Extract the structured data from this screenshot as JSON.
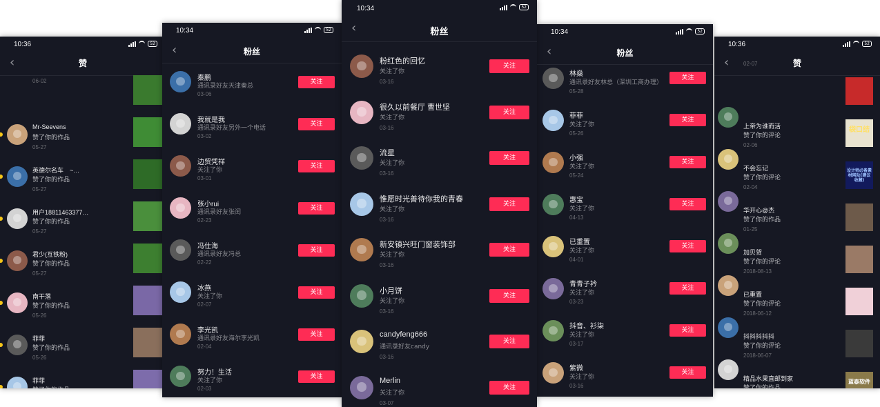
{
  "status_bar": {
    "time_left": "10:36",
    "time_left2": "10:34",
    "time_center": "10:34",
    "time_right2": "10:34",
    "time_right": "10:36",
    "battery": "52"
  },
  "screens": {
    "likes_left": {
      "title": "赞",
      "rows": [
        {
          "name": "",
          "action": "",
          "date": "06-02"
        },
        {
          "name": "Mr-Seevens",
          "action": "赞了你的作品",
          "date": "05-27"
        },
        {
          "name": "英德尔名车　~…",
          "action": "赞了你的作品",
          "date": "05-27"
        },
        {
          "name": "用户18811463377…",
          "action": "赞了你的作品",
          "date": "05-27"
        },
        {
          "name": "君少(互铁粉)",
          "action": "赞了你的作品",
          "date": "05-27"
        },
        {
          "name": "南干落",
          "action": "赞了你的作品",
          "date": "05-26"
        },
        {
          "name": "菲菲",
          "action": "赞了你的作品",
          "date": "05-26"
        },
        {
          "name": "菲菲",
          "action": "赞了你的作品",
          "date": "05-26"
        }
      ]
    },
    "fans_left": {
      "title": "粉丝",
      "follow_label": "关注",
      "rows": [
        {
          "name": "秦鹏",
          "sub": "通讯录好友天津秦总",
          "date": "03-06"
        },
        {
          "name": "我就是我",
          "sub": "通讯录好友另外一个电话",
          "date": "03-02"
        },
        {
          "name": "边贸凭祥",
          "sub": "关注了你",
          "date": "03-01"
        },
        {
          "name": "张小rui",
          "sub": "通讯录好友张闰",
          "date": "02-23"
        },
        {
          "name": "冯仕海",
          "sub": "通讯录好友冯总",
          "date": "02-22"
        },
        {
          "name": "冰燕",
          "sub": "关注了你",
          "date": "02-07"
        },
        {
          "name": "李光凯",
          "sub": "通讯录好友海尔李光凯",
          "date": "02-04"
        },
        {
          "name": "努力！生活",
          "sub": "关注了你",
          "date": "02-03"
        }
      ]
    },
    "fans_center": {
      "title": "粉丝",
      "follow_label": "关注",
      "rows": [
        {
          "name": "粉红色的回忆",
          "sub": "关注了你",
          "date": "03-16"
        },
        {
          "name": "很久以前餐厅  曹世坚",
          "sub": "关注了你",
          "date": "03-16"
        },
        {
          "name": "流星",
          "sub": "关注了你",
          "date": "03-16"
        },
        {
          "name": "惟愿时光善待你我的青春",
          "sub": "关注了你",
          "date": "03-16"
        },
        {
          "name": "新安镇兴旺门窗装饰部",
          "sub": "关注了你",
          "date": "03-16"
        },
        {
          "name": "小月饼",
          "sub": "关注了你",
          "date": "03-16"
        },
        {
          "name": "candyfeng666",
          "sub": "通讯录好友candy",
          "date": "03-16"
        },
        {
          "name": "Merlin",
          "sub": "关注了你",
          "date": "03-07"
        }
      ]
    },
    "fans_right": {
      "title": "粉丝",
      "follow_label": "关注",
      "rows": [
        {
          "name": "林燊",
          "sub": "通讯录好友林总（深圳工商办理）",
          "date": "05-28"
        },
        {
          "name": "菲菲",
          "sub": "关注了你",
          "date": "05-26"
        },
        {
          "name": "小强",
          "sub": "关注了你",
          "date": "05-24"
        },
        {
          "name": "惠宝",
          "sub": "关注了你",
          "date": "04-13"
        },
        {
          "name": "已重置",
          "sub": "关注了你",
          "date": "04-01"
        },
        {
          "name": "青青子衿",
          "sub": "关注了你",
          "date": "03-23"
        },
        {
          "name": "抖音、衫柒",
          "sub": "关注了你",
          "date": "03-17"
        },
        {
          "name": "紫微",
          "sub": "关注了你",
          "date": "03-16"
        }
      ]
    },
    "likes_right": {
      "title": "赞",
      "rows": [
        {
          "name": "",
          "action": "",
          "date": "02-07"
        },
        {
          "name": "上帝为谁而活",
          "action": "赞了你的评论",
          "date": "02-06"
        },
        {
          "name": "不会忘记",
          "action": "赞了你的评论",
          "date": "02-04"
        },
        {
          "name": "华开心@杰",
          "action": "赞了你的作品",
          "date": "01-25"
        },
        {
          "name": "加贝贺",
          "action": "赞了你的评论",
          "date": "2018-08-13"
        },
        {
          "name": "已重置",
          "action": "赞了你的评论",
          "date": "2018-06-12"
        },
        {
          "name": "抖抖抖抖抖",
          "action": "赞了你的评论",
          "date": "2018-06-07"
        },
        {
          "name": "精品水果直邮到家",
          "action": "赞了你的作品",
          "date": "2018-06-03"
        }
      ]
    }
  },
  "thumb_texts": {
    "t1": "袋口结",
    "t2": "设计师必备素材网站(建议收藏)",
    "t3": "蓝泰软件"
  },
  "colors": {
    "background": "#161823",
    "accent": "#fe2c55",
    "text": "#e9e9ea",
    "muted": "#8a8b91"
  }
}
